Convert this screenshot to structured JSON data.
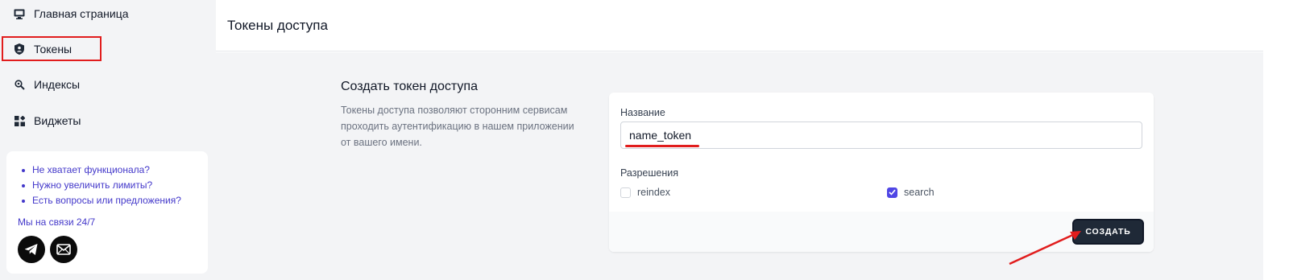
{
  "sidebar": {
    "items": [
      {
        "label": "Главная страница",
        "icon": "monitor-icon"
      },
      {
        "label": "Токены",
        "icon": "shield-user-icon",
        "active": true
      },
      {
        "label": "Индексы",
        "icon": "magnifier-icon"
      },
      {
        "label": "Виджеты",
        "icon": "widgets-icon"
      }
    ],
    "help": {
      "links": [
        "Не хватает функционала?",
        "Нужно увеличить лимиты?",
        "Есть вопросы или предложения?"
      ],
      "support_text": "Мы на связи 24/7",
      "social": [
        "telegram-icon",
        "mail-icon"
      ]
    }
  },
  "header": {
    "title": "Токены доступа"
  },
  "intro": {
    "title": "Создать токен доступа",
    "description": "Токены доступа позволяют сторонним сервисам проходить аутентификацию в нашем приложении от вашего имени."
  },
  "form": {
    "name_label": "Название",
    "name_value": "name_token",
    "permissions_label": "Разрешения",
    "permissions": [
      {
        "label": "reindex",
        "checked": false
      },
      {
        "label": "search",
        "checked": true
      }
    ],
    "submit_label": "СОЗДАТЬ"
  },
  "colors": {
    "accent": "#4f46e5",
    "annotation": "#e11d1d",
    "button": "#1f2937"
  }
}
